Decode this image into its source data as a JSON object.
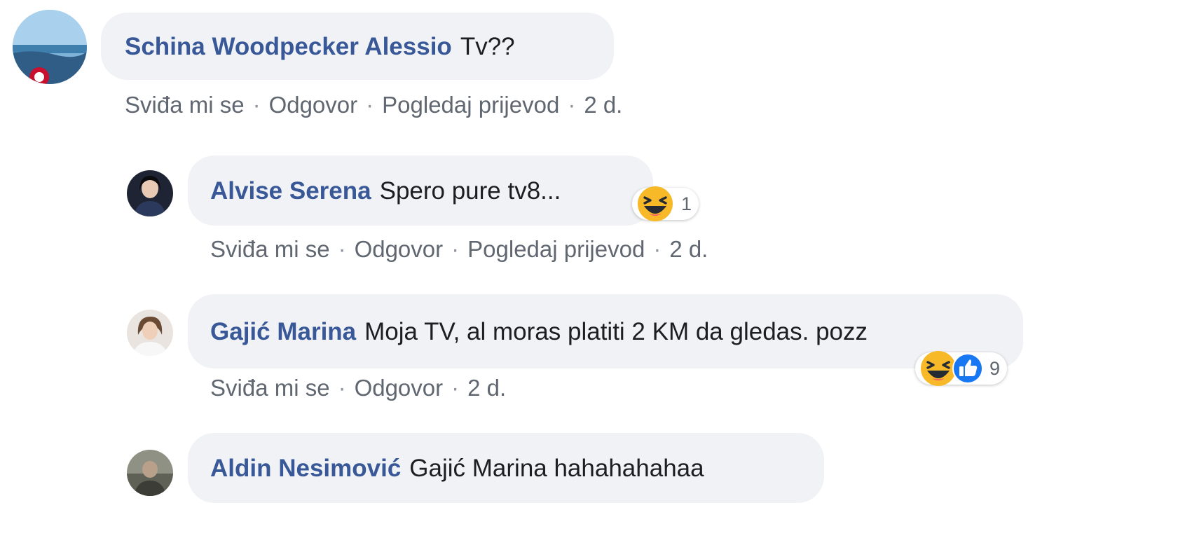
{
  "comments": [
    {
      "author": "Schina Woodpecker Alessio",
      "text": "Tv??",
      "actions": {
        "like": "Sviđa mi se",
        "reply": "Odgovor",
        "translate": "Pogledaj prijevod",
        "time": "2 d."
      }
    },
    {
      "author": "Alvise Serena",
      "text": "Spero pure tv8...",
      "actions": {
        "like": "Sviđa mi se",
        "reply": "Odgovor",
        "translate": "Pogledaj prijevod",
        "time": "2 d."
      },
      "reactions": {
        "icons": [
          "haha-icon"
        ],
        "count": "1"
      }
    },
    {
      "author": "Gajić Marina",
      "text": "Moja TV, al moras platiti 2 KM da gledas. pozz",
      "actions": {
        "like": "Sviđa mi se",
        "reply": "Odgovor",
        "time": "2 d."
      },
      "reactions": {
        "icons": [
          "haha-icon",
          "like-icon"
        ],
        "count": "9"
      }
    },
    {
      "author": "Aldin Nesimović",
      "text": "Gajić Marina hahahahahaa"
    }
  ],
  "separator": "·",
  "colors": {
    "author": "#385898",
    "bubble": "#f1f2f6",
    "meta": "#606770",
    "like": "#1877f2",
    "haha": "#f7b928"
  }
}
